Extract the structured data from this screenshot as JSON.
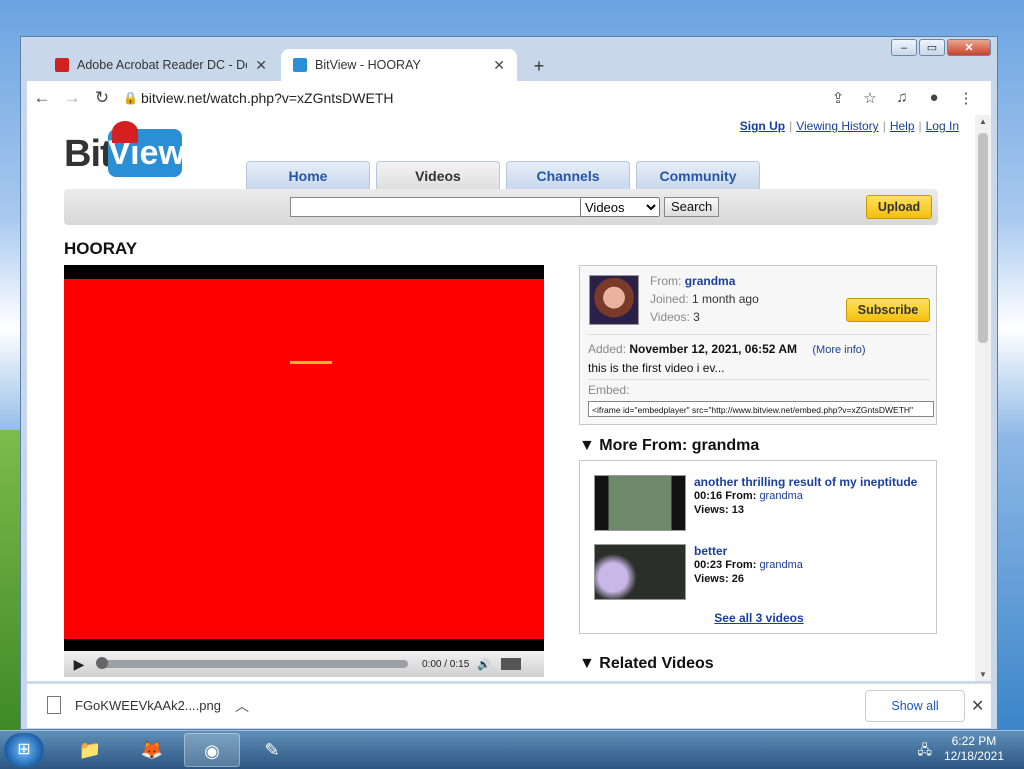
{
  "browser": {
    "tabs": [
      {
        "title": "Adobe Acrobat Reader DC - Dow",
        "favicon_color": "#d32020"
      },
      {
        "title": "BitView - HOORAY",
        "favicon_color": "#2b8fd6"
      }
    ],
    "url": "bitview.net/watch.php?v=xZGntsDWETH"
  },
  "site": {
    "logo_bit": "Bit",
    "logo_view": "View",
    "toplinks": [
      "Sign Up",
      "Viewing History",
      "Help",
      "Log In"
    ],
    "nav": [
      "Home",
      "Videos",
      "Channels",
      "Community"
    ],
    "search": {
      "value": "",
      "category": "Videos",
      "button": "Search"
    },
    "upload": "Upload"
  },
  "video": {
    "title": "HOORAY",
    "time": "0:00 / 0:15",
    "from_label": "From:",
    "from": "grandma",
    "joined_label": "Joined:",
    "joined": "1 month ago",
    "videos_label": "Videos:",
    "videos": "3",
    "subscribe": "Subscribe",
    "added_label": "Added:",
    "added": "November 12, 2021, 06:52 AM",
    "more_info": "(More info)",
    "description": "this is the first video i ev...",
    "embed_label": "Embed:",
    "embed_code": "<iframe id=\"embedplayer\" src=\"http://www.bitview.net/embed.php?v=xZGntsDWETH\""
  },
  "more_from": {
    "heading": "More From: grandma",
    "items": [
      {
        "title": "another thrilling result of my ineptitude",
        "duration": "00:16",
        "from_label": "From:",
        "from": "grandma",
        "views_label": "Views:",
        "views": "13"
      },
      {
        "title": "better",
        "duration": "00:23",
        "from_label": "From:",
        "from": "grandma",
        "views_label": "Views:",
        "views": "26"
      }
    ],
    "see_all": "See all 3 videos"
  },
  "related": {
    "heading": "Related Videos"
  },
  "download": {
    "filename": "FGoKWEEVkAAk2....png",
    "show_all": "Show all"
  },
  "taskbar": {
    "time": "6:22 PM",
    "date": "12/18/2021"
  }
}
